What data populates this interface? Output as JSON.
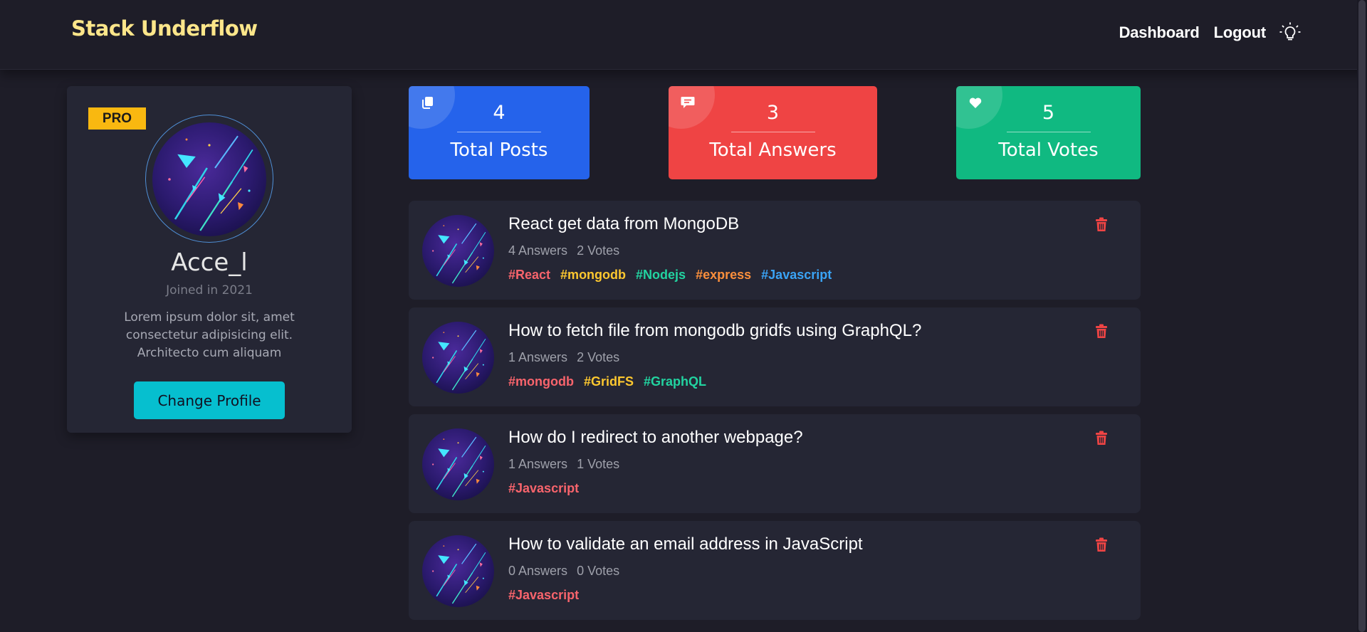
{
  "header": {
    "brand": "Stack Underflow",
    "nav": [
      "Dashboard",
      "Logout"
    ],
    "theme_toggle_icon": "lightbulb-icon"
  },
  "profile": {
    "badge": "PRO",
    "username": "Acce_l",
    "joined": "Joined in 2021",
    "bio": "Lorem ipsum dolor sit, amet consectetur adipisicing elit. Architecto cum aliquam",
    "change_button": "Change Profile"
  },
  "stats": [
    {
      "value": "4",
      "label": "Total Posts",
      "icon": "copy-icon",
      "color": "#2563eb"
    },
    {
      "value": "3",
      "label": "Total Answers",
      "icon": "comment-icon",
      "color": "#ef4444"
    },
    {
      "value": "5",
      "label": "Total Votes",
      "icon": "heart-icon",
      "color": "#10b981"
    }
  ],
  "posts": [
    {
      "title": "React get data from MongoDB",
      "answers": "4 Answers",
      "votes": "2 Votes",
      "tags": [
        "#React",
        "#mongodb",
        "#Nodejs",
        "#express",
        "#Javascript"
      ]
    },
    {
      "title": "How to fetch file from mongodb gridfs using GraphQL?",
      "answers": "1 Answers",
      "votes": "2 Votes",
      "tags": [
        "#mongodb",
        "#GridFS",
        "#GraphQL"
      ]
    },
    {
      "title": "How do I redirect to another webpage?",
      "answers": "1 Answers",
      "votes": "1 Votes",
      "tags": [
        "#Javascript"
      ]
    },
    {
      "title": "How to validate an email address in JavaScript",
      "answers": "0 Answers",
      "votes": "0 Votes",
      "tags": [
        "#Javascript"
      ]
    }
  ],
  "tag_colors": [
    "#f8646c",
    "#fcc72f",
    "#22d3a0",
    "#fb8f3c",
    "#3aa3f5"
  ],
  "delete_icon": "trash-icon",
  "delete_color": "#ef4444"
}
